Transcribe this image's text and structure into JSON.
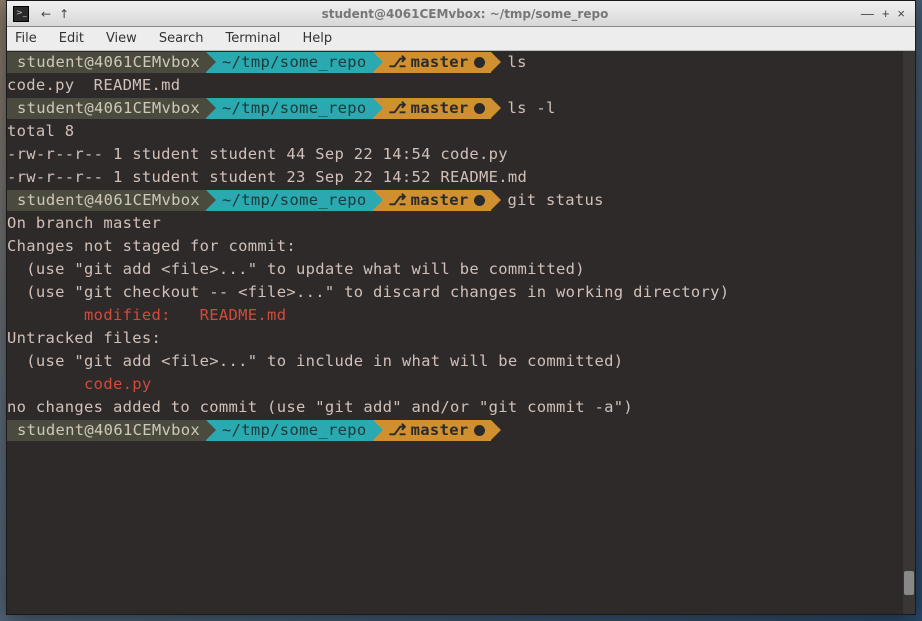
{
  "window": {
    "title": "student@4061CEMvbox: ~/tmp/some_repo"
  },
  "menu": {
    "file": "File",
    "edit": "Edit",
    "view": "View",
    "search": "Search",
    "terminal": "Terminal",
    "help": "Help"
  },
  "prompt": {
    "user": "student@4061CEMvbox",
    "path": "~/tmp/some_repo",
    "branch": "master",
    "branch_symbol": "⎇"
  },
  "session": {
    "cmd1": "ls",
    "out1": "code.py  README.md",
    "cmd2": "ls -l",
    "out2a": "total 8",
    "out2b": "-rw-r--r-- 1 student student 44 Sep 22 14:54 code.py",
    "out2c": "-rw-r--r-- 1 student student 23 Sep 22 14:52 README.md",
    "cmd3": "git status",
    "gs1": "On branch master",
    "gs2": "Changes not staged for commit:",
    "gs3": "  (use \"git add <file>...\" to update what will be committed)",
    "gs4": "  (use \"git checkout -- <file>...\" to discard changes in working directory)",
    "gs5": "",
    "gs6": "        modified:   README.md",
    "gs7": "",
    "gs8": "Untracked files:",
    "gs9": "  (use \"git add <file>...\" to include in what will be committed)",
    "gs10": "",
    "gs11": "        code.py",
    "gs12": "",
    "gs13": "no changes added to commit (use \"git add\" and/or \"git commit -a\")"
  }
}
